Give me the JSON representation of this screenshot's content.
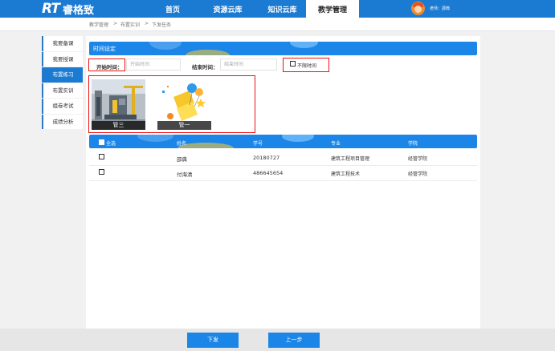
{
  "header": {
    "logo_mark": "RT",
    "logo_text": "睿格致",
    "nav": [
      "首页",
      "资源云库",
      "知识云库",
      "教学管理"
    ],
    "user": "老师：邵典"
  },
  "breadcrumb": {
    "items": [
      "教学管理",
      "布置实训",
      "下发任务"
    ],
    "separator": ">"
  },
  "sidebar": {
    "items": [
      "我要备课",
      "我要授课",
      "布置练习",
      "布置实训",
      "组卷考试",
      "成绩分析"
    ],
    "active_index": 2
  },
  "time_section": {
    "title": "时间设定",
    "start_label": "开始时间：",
    "start_placeholder": "开始时间",
    "end_label": "结束时间：",
    "end_placeholder": "结束时间",
    "unlimited_label": "不限时间"
  },
  "cards": [
    {
      "caption": "管三"
    },
    {
      "caption": "管一"
    }
  ],
  "table": {
    "select_all": "全选",
    "headers": [
      "姓名",
      "学号",
      "专业",
      "学院"
    ],
    "rows": [
      [
        "邵典",
        "20180727",
        "建筑工程项目管理",
        "经管学院"
      ],
      [
        "付海清",
        "486645654",
        "建筑工程技术",
        "经管学院"
      ]
    ]
  },
  "buttons": {
    "submit": "下发",
    "prev": "上一步"
  },
  "colors": {
    "primary": "#1b7ad2",
    "header_blue": "#1b86e8",
    "highlight": "#e11111"
  }
}
